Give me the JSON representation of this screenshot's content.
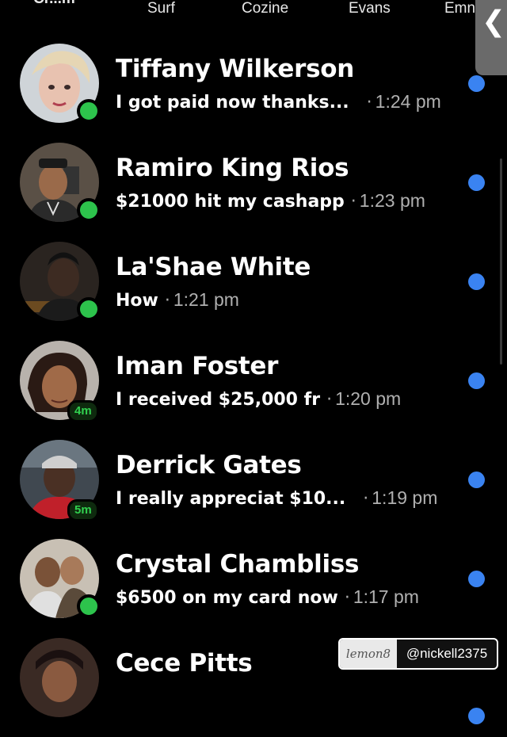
{
  "stories": {
    "items": [
      {
        "label": "Cr...m"
      },
      {
        "label": "Surf"
      },
      {
        "label": "Cozine"
      },
      {
        "label": "Evans"
      },
      {
        "label": "Emn"
      }
    ]
  },
  "back_tab": {
    "glyph": "❮",
    "icon": "chevron-left-icon"
  },
  "chats": [
    {
      "name": "Tiffany Wilkerson",
      "message": "I got paid now thanks...",
      "separator": "·",
      "time": "1:24 pm",
      "presence": "online",
      "unread": true
    },
    {
      "name": "Ramiro King Rios",
      "message": "$21000 hit my cashapp",
      "separator": "·",
      "time": "1:23 pm",
      "presence": "online",
      "unread": true
    },
    {
      "name": "La'Shae White",
      "message": "How",
      "separator": "·",
      "time": "1:21 pm",
      "presence": "online",
      "unread": true
    },
    {
      "name": "Iman Foster",
      "message": "I received $25,000 fr",
      "separator": "·",
      "time": "1:20 pm",
      "presence_badge": "4m",
      "unread": true
    },
    {
      "name": "Derrick Gates",
      "message": "I really appreciat $10...",
      "separator": "·",
      "time": "1:19 pm",
      "presence_badge": "5m",
      "unread": true
    },
    {
      "name": "Crystal Chambliss",
      "message": "$6500 on my card now",
      "separator": "·",
      "time": "1:17 pm",
      "presence": "online",
      "unread": true
    },
    {
      "name": "Cece Pitts",
      "message": "",
      "separator": "",
      "time": "",
      "unread": true
    }
  ],
  "watermark": {
    "logo": "lemon8",
    "handle": "@nickell2375"
  },
  "colors": {
    "background": "#000000",
    "unread_dot": "#3a83f1",
    "presence": "#2dc34c",
    "badge_text": "#31d14f"
  }
}
